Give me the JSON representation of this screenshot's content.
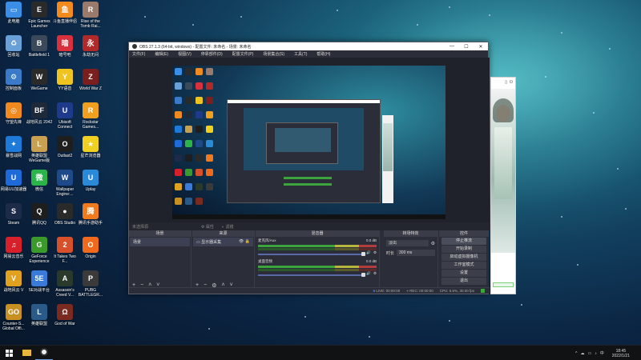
{
  "desktop": {
    "icons": [
      {
        "label": "此电脑",
        "color": "#3a8ee6",
        "glyph": "▭"
      },
      {
        "label": "Epic Games Launcher",
        "color": "#2a2a2a",
        "glyph": "E"
      },
      {
        "label": "斗鱼直播伴侣",
        "color": "#f28a1e",
        "glyph": "鱼"
      },
      {
        "label": "Rise of the Tomb Rai...",
        "color": "#9a7a6a",
        "glyph": "R"
      },
      {
        "label": "回收站",
        "color": "#6aa0d8",
        "glyph": "♻"
      },
      {
        "label": "Battlefield 1",
        "color": "#3a4a5a",
        "glyph": "B"
      },
      {
        "label": "暗号吧",
        "color": "#d8303c",
        "glyph": "暗"
      },
      {
        "label": "永劫无间",
        "color": "#b02a2a",
        "glyph": "永"
      },
      {
        "label": "控制面板",
        "color": "#3a7ac8",
        "glyph": "⚙"
      },
      {
        "label": "WeGame",
        "color": "#2a2a2a",
        "glyph": "W"
      },
      {
        "label": "YY语音",
        "color": "#f0c420",
        "glyph": "Y"
      },
      {
        "label": "World War Z",
        "color": "#7a1e1e",
        "glyph": "Z"
      },
      {
        "label": "守望先锋",
        "color": "#f08a1e",
        "glyph": "◎"
      },
      {
        "label": "战地风云 2042",
        "color": "#1e2a3a",
        "glyph": "BF"
      },
      {
        "label": "Ubisoft Connect",
        "color": "#1e3a8a",
        "glyph": "U"
      },
      {
        "label": "Rockstar Games...",
        "color": "#f0a01e",
        "glyph": "R"
      },
      {
        "label": "暴雪战网",
        "color": "#1e7ad8",
        "glyph": "✦"
      },
      {
        "label": "英雄联盟 WeGame版",
        "color": "#c8a050",
        "glyph": "L"
      },
      {
        "label": "Outlast2",
        "color": "#1e1e1e",
        "glyph": "O"
      },
      {
        "label": "星芒浏览器",
        "color": "#f0d020",
        "glyph": "★"
      },
      {
        "label": "网易UU加速器",
        "color": "#1e6ad8",
        "glyph": "U"
      },
      {
        "label": "微信",
        "color": "#2ab44a",
        "glyph": "微"
      },
      {
        "label": "Wallpaper Engine:...",
        "color": "#1e4a8a",
        "glyph": "W"
      },
      {
        "label": "Uplay",
        "color": "#2a8ad8",
        "glyph": "U"
      },
      {
        "label": "Steam",
        "color": "#1e2a4a",
        "glyph": "S"
      },
      {
        "label": "腾讯QQ",
        "color": "#1e1e1e",
        "glyph": "Q"
      },
      {
        "label": "OBS Studio",
        "color": "#2a2a2a",
        "glyph": "●"
      },
      {
        "label": "腾讯手游助手",
        "color": "#f07a1e",
        "glyph": "腾"
      },
      {
        "label": "网易云音乐",
        "color": "#d8202a",
        "glyph": "♫"
      },
      {
        "label": "GeForce Experience",
        "color": "#3a9a2a",
        "glyph": "G"
      },
      {
        "label": "It Takes Two F...",
        "color": "#d8502a",
        "glyph": "2"
      },
      {
        "label": "Origin",
        "color": "#f06a1e",
        "glyph": "O"
      },
      {
        "label": "战地风云 V",
        "color": "#e0a020",
        "glyph": "V"
      },
      {
        "label": "5E对战平台",
        "color": "#3a7ad8",
        "glyph": "5E"
      },
      {
        "label": "Assassin's Creed V...",
        "color": "#2a3a2a",
        "glyph": "A"
      },
      {
        "label": "PUBG BATTLEGR...",
        "color": "#3a3a3a",
        "glyph": "P"
      },
      {
        "label": "Counter-S... Global Offi...",
        "color": "#c89020",
        "glyph": "GO"
      },
      {
        "label": "英雄联盟",
        "color": "#2a5a8a",
        "glyph": "L"
      },
      {
        "label": "God of War",
        "color": "#7a2a1e",
        "glyph": "Ω"
      }
    ]
  },
  "obs": {
    "title": "OBS 27.1.3 (64-bit, windows) - 配置文件: 未命名 - 场景: 未命名",
    "menu": [
      "文件(F)",
      "编辑(E)",
      "视图(V)",
      "停靠部件(D)",
      "配置文件(P)",
      "场景集合(S)",
      "工具(T)",
      "帮助(H)"
    ],
    "window_controls": [
      "—",
      "☐",
      "✕"
    ],
    "preview_bar": [
      "未选择源",
      "属性",
      "滤镜"
    ],
    "docks": {
      "scenes": {
        "title": "场景",
        "items": [
          "场景"
        ]
      },
      "sources": {
        "title": "来源",
        "items": [
          "显示器采集"
        ]
      },
      "mixer": {
        "title": "混音器",
        "tracks": [
          {
            "name": "麦克风/Aux",
            "db": "0.0 dB"
          },
          {
            "name": "桌面音频",
            "db": "0.0 dB"
          }
        ]
      },
      "transitions": {
        "title": "转场特效",
        "type": "淡出",
        "duration_label": "时长",
        "duration": "300 ms"
      },
      "controls": {
        "title": "控件",
        "buttons": [
          "停止推流",
          "开始录制",
          "启动虚拟摄像机",
          "工作室模式",
          "设置",
          "退出"
        ]
      }
    },
    "status": [
      "LIVE: 00:00:00",
      "REC: 00:00:00",
      "CPU: 6.6%, 30.00 fps"
    ]
  },
  "taskbar": {
    "time": "18:45",
    "date": "2022/1/21",
    "lang": "中",
    "tray": [
      "^",
      "☁",
      "▭",
      "♪",
      "中"
    ]
  }
}
